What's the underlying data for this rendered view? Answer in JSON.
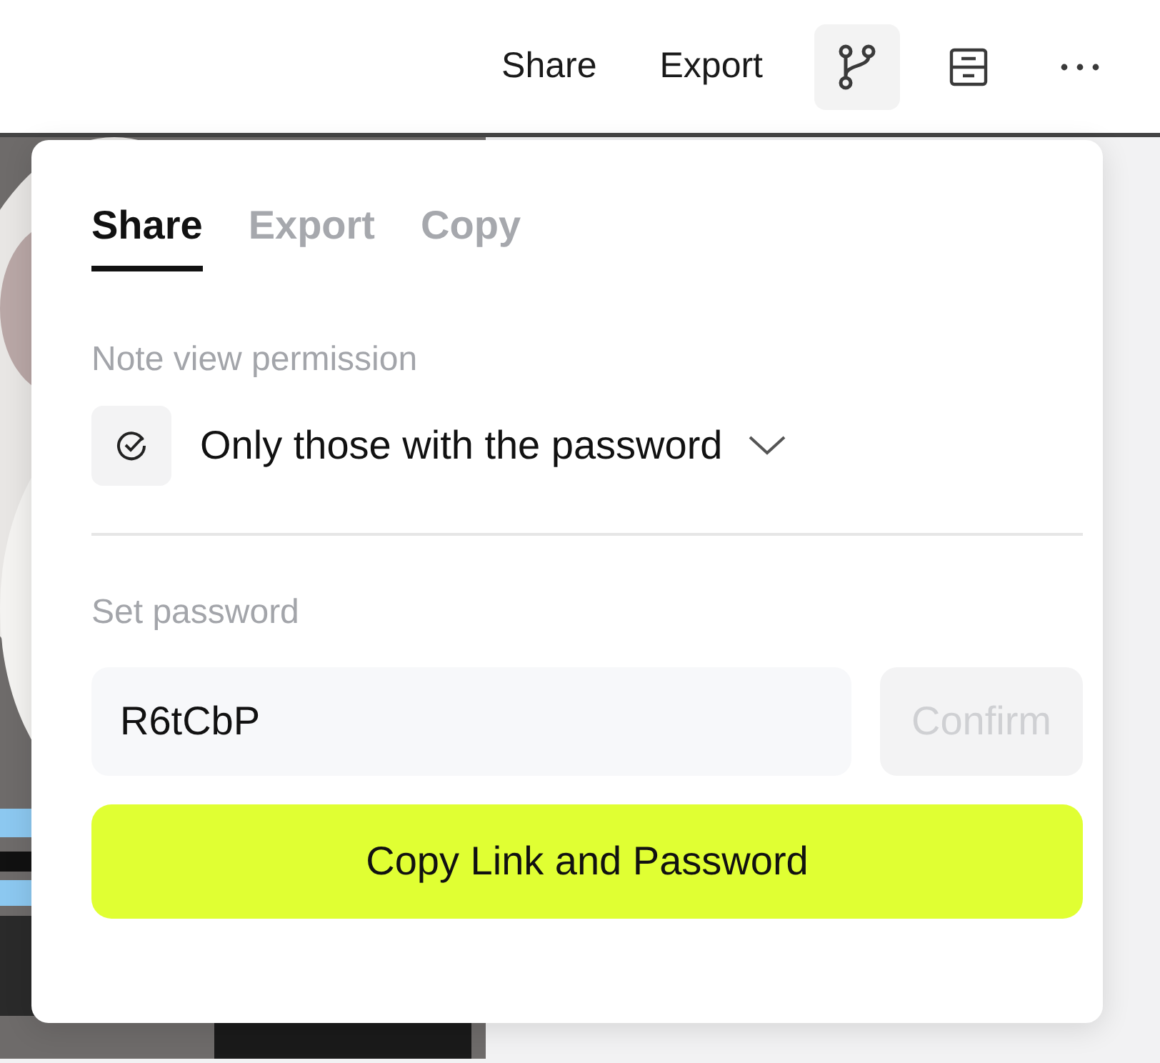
{
  "toolbar": {
    "links": [
      {
        "label": "Share"
      },
      {
        "label": "Export"
      }
    ],
    "icon_buttons": [
      {
        "selected": true
      },
      {
        "selected": false
      },
      {
        "selected": false
      }
    ]
  },
  "popup": {
    "tabs": [
      {
        "label": "Share",
        "selected": true
      },
      {
        "label": "Export",
        "selected": false
      },
      {
        "label": "Copy",
        "selected": false
      }
    ],
    "permission": {
      "label": "Note view permission",
      "value": "Only those with the password"
    },
    "password": {
      "label": "Set password",
      "value": "R6tCbP",
      "confirm": {
        "label": "Confirm",
        "disabled": true
      }
    },
    "copy_button": {
      "label": "Copy Link and Password"
    }
  }
}
